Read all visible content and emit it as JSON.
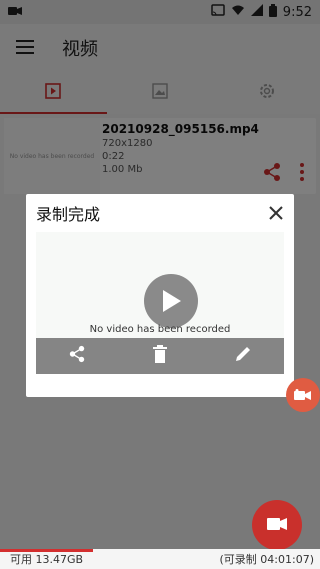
{
  "status_bar": {
    "time": "9:52"
  },
  "app_bar": {
    "title": "视频"
  },
  "tabs": [
    {
      "name": "video-tab",
      "icon": "play-square-icon",
      "active": true
    },
    {
      "name": "image-tab",
      "icon": "image-icon",
      "active": false
    },
    {
      "name": "settings-tab",
      "icon": "gear-icon",
      "active": false
    }
  ],
  "video_item": {
    "filename": "20210928_095156.mp4",
    "resolution": "720x1280",
    "duration": "0:22",
    "size": "1.00 Mb",
    "thumb_text": "No video has been recorded"
  },
  "dialog": {
    "title": "录制完成",
    "no_video_text": "No video has been recorded"
  },
  "storage": {
    "available": "可用 13.47GB",
    "recordable": "(可录制 04:01:07)",
    "used_fraction": 0.29
  },
  "colors": {
    "accent": "#d32f2f",
    "fab_small": "#e05c42"
  }
}
